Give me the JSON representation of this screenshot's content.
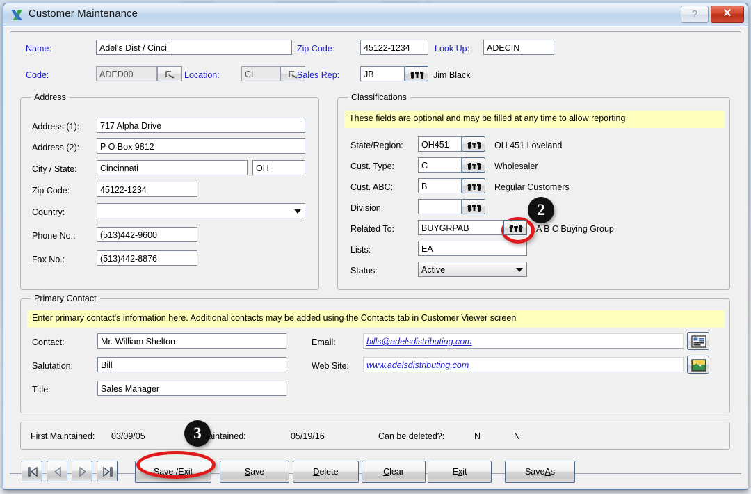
{
  "window": {
    "title": "Customer Maintenance",
    "app_icon": "x-logo-icon",
    "help_label": "?",
    "close_label": "✕"
  },
  "header_fields": {
    "name_label": "Name:",
    "name_value": "Adel's Dist / Cinci",
    "zip_label": "Zip Code:",
    "zip_value": "45122-1234",
    "lookup_label": "Look Up:",
    "lookup_value": "ADECIN",
    "code_label": "Code:",
    "code_value": "ADED00",
    "location_label": "Location:",
    "location_value": "CI",
    "sales_rep_label": "Sales Rep:",
    "sales_rep_value": "JB",
    "sales_rep_desc": "Jim Black"
  },
  "address": {
    "title": "Address",
    "rows": [
      {
        "label": "Address (1):",
        "value": "717 Alpha Drive"
      },
      {
        "label": "Address (2):",
        "value": "P O Box 9812"
      },
      {
        "label": "City / State:",
        "value": "Cincinnati",
        "value2": "OH"
      },
      {
        "label": "Zip Code:",
        "value": "45122-1234"
      },
      {
        "label": "Country:",
        "value": ""
      },
      {
        "label": "Phone No.:",
        "value": "(513)442-9600"
      },
      {
        "label": "Fax No.:",
        "value": "(513)442-8876"
      }
    ]
  },
  "classifications": {
    "title": "Classifications",
    "banner": "These fields are optional and may be filled at any time to allow reporting",
    "rows": [
      {
        "label": "State/Region:",
        "value": "OH451",
        "desc": "OH 451 Loveland"
      },
      {
        "label": "Cust. Type:",
        "value": "C",
        "desc": "Wholesaler"
      },
      {
        "label": "Cust. ABC:",
        "value": "B",
        "desc": "Regular Customers"
      },
      {
        "label": "Division:",
        "value": "",
        "desc": ""
      },
      {
        "label": "Related To:",
        "value": "BUYGRPAB",
        "desc": "A B C Buying Group"
      }
    ],
    "lists_label": "Lists:",
    "lists_value": "EA",
    "status_label": "Status:",
    "status_value": "Active"
  },
  "primary_contact": {
    "title": "Primary Contact",
    "banner": "Enter primary contact's information here. Additional contacts may be added using the Contacts tab in Customer Viewer screen",
    "contact_label": "Contact:",
    "contact_value": "Mr. William Shelton",
    "salutation_label": "Salutation:",
    "salutation_value": "Bill",
    "title_label": "Title:",
    "title_value": "Sales Manager",
    "email_label": "Email:",
    "email_value": "bills@adelsdistributing.com",
    "website_label": "Web Site:",
    "website_value": "www.adelsdistributing.com",
    "email_icon": "envelope-card-icon",
    "website_icon": "picture-globe-icon"
  },
  "status_bar": {
    "first_maintained_label": "First Maintained:",
    "first_maintained_value": "03/09/05",
    "maintained_label": "Maintained:",
    "maintained_value": "05/19/16",
    "can_be_deleted_label": "Can be deleted?:",
    "can_be_deleted_value1": "N",
    "can_be_deleted_value2": "N"
  },
  "nav_buttons": [
    {
      "name": "first-record-button",
      "glyph": "|◀"
    },
    {
      "name": "previous-record-button",
      "glyph": "◀"
    },
    {
      "name": "next-record-button",
      "glyph": "▶"
    },
    {
      "name": "last-record-button",
      "glyph": "▶|"
    }
  ],
  "action_buttons": {
    "save_exit": {
      "pre": "Save / ",
      "accel": "E",
      "post": "xit"
    },
    "save": {
      "pre": "",
      "accel": "S",
      "post": "ave"
    },
    "delete": {
      "pre": "",
      "accel": "D",
      "post": "elete"
    },
    "clear": {
      "pre": "",
      "accel": "C",
      "post": "lear"
    },
    "exit": {
      "pre": "E",
      "accel": "x",
      "post": "it"
    },
    "save_as": {
      "pre": "Save ",
      "accel": "A",
      "post": "s"
    }
  },
  "annotations": {
    "badge2": "2",
    "badge3": "3"
  },
  "colors": {
    "accent_label": "#1b1bd0",
    "banner_yellow": "#ffffbe",
    "annotation_red": "#e01b1b",
    "close_red": "#d4452c"
  }
}
